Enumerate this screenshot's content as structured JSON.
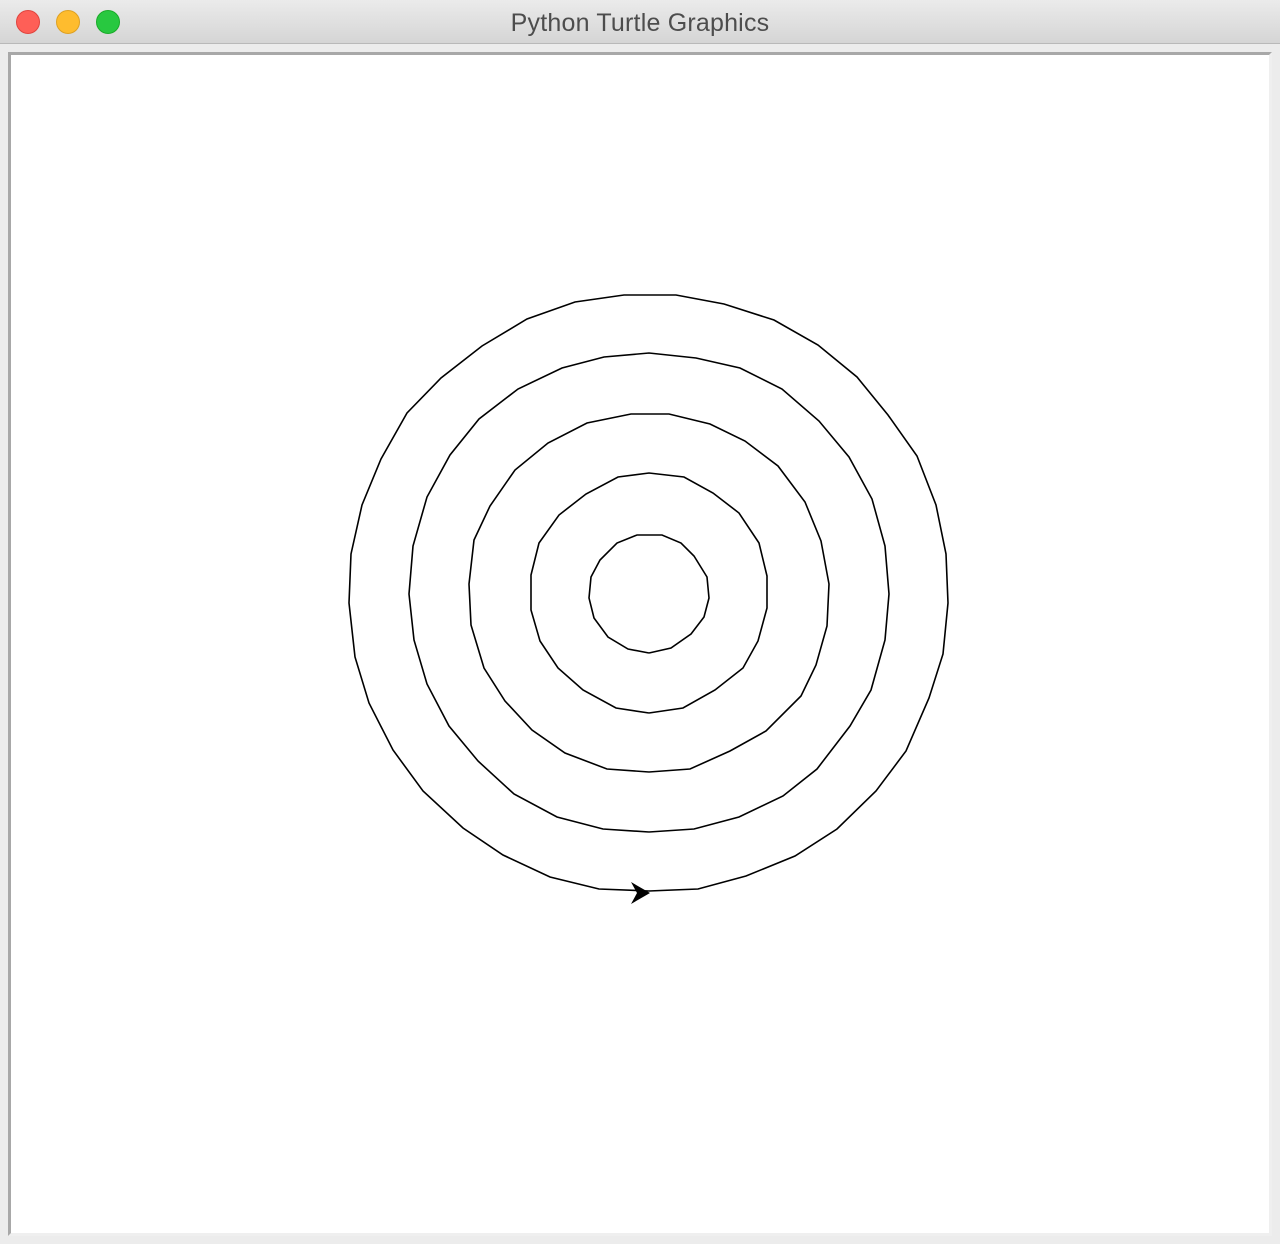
{
  "window": {
    "title": "Python Turtle Graphics",
    "controls": {
      "close_color": "#fe5f57",
      "minimize_color": "#febc2e",
      "zoom_color": "#28c840"
    }
  },
  "canvas": {
    "background": "#ffffff",
    "pen_color": "#000000",
    "drawing": "concentric-spiral-rings",
    "ring_count": 5,
    "turtle_shape": "arrow-icon"
  }
}
